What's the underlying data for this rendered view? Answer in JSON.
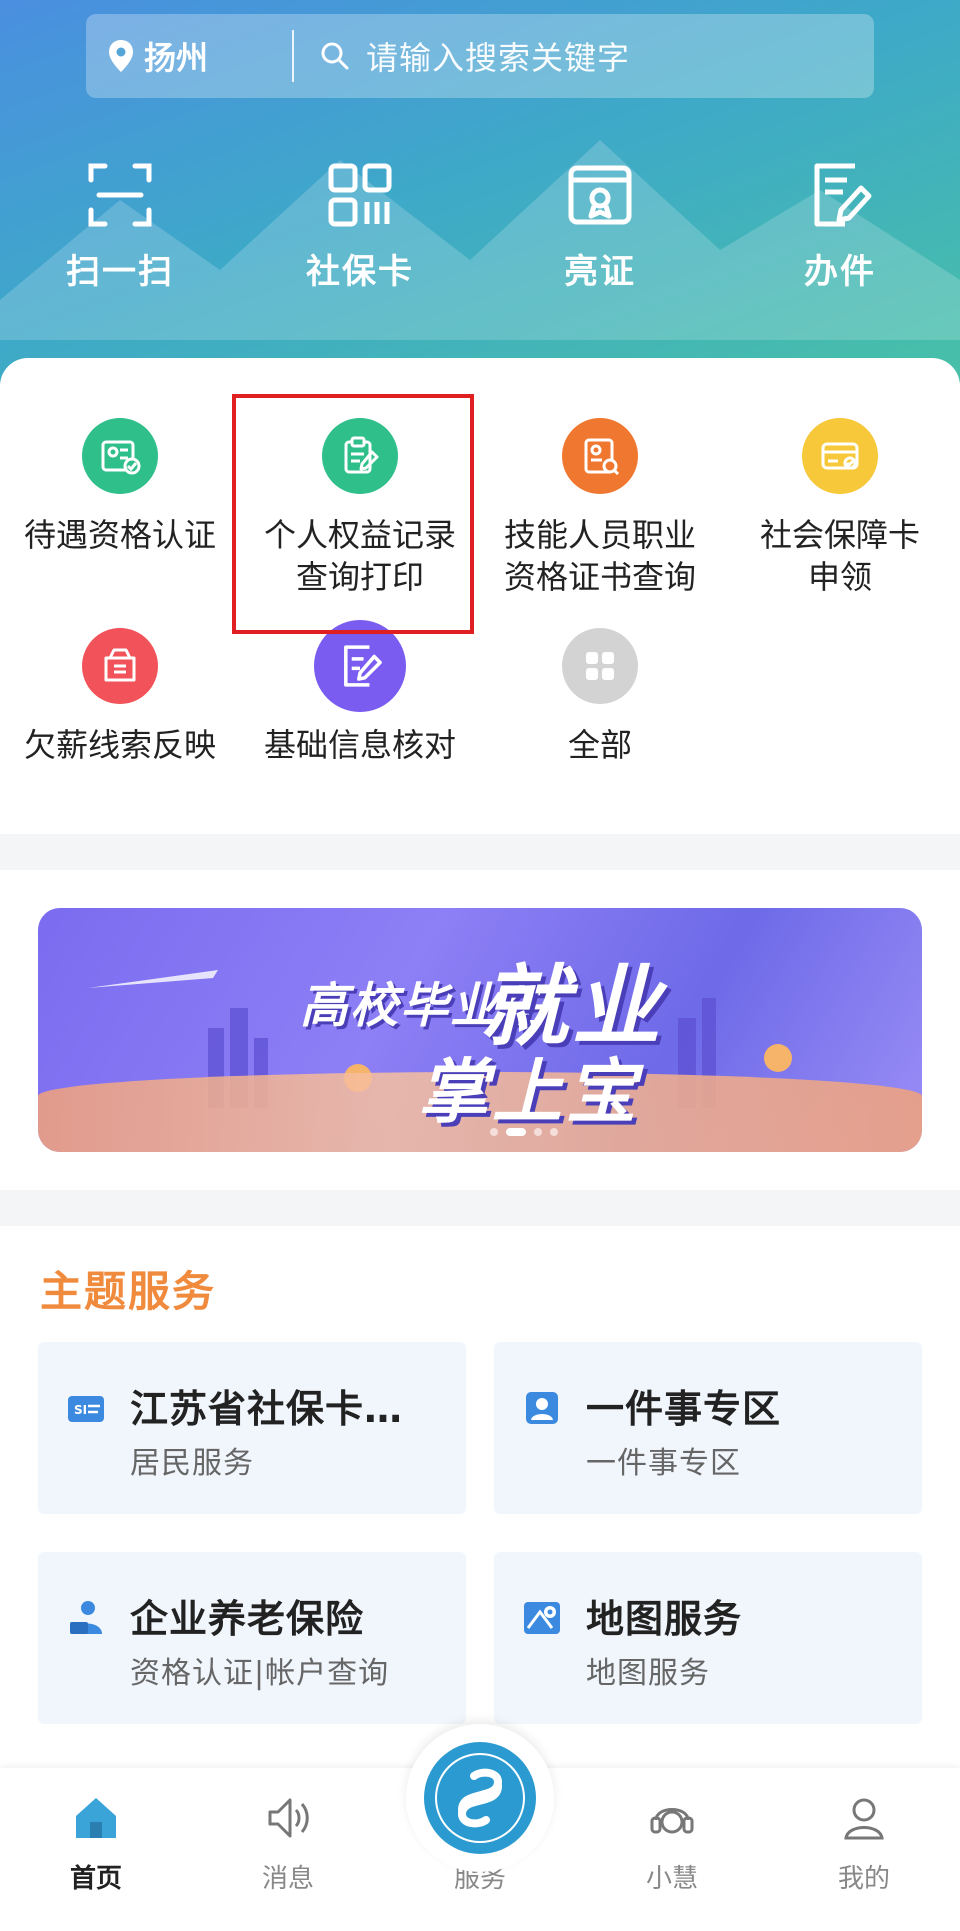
{
  "header": {
    "location": "扬州",
    "search_placeholder": "请输入搜索关键字",
    "quick_actions": [
      {
        "label": "扫一扫",
        "icon": "scan-icon"
      },
      {
        "label": "社保卡",
        "icon": "qr-card-icon"
      },
      {
        "label": "亮证",
        "icon": "certificate-icon"
      },
      {
        "label": "办件",
        "icon": "edit-document-icon"
      }
    ]
  },
  "services": [
    {
      "label": "待遇资格认证",
      "icon": "id-verify-icon",
      "color": "#2fbf8a"
    },
    {
      "label": "个人权益记录\n查询打印",
      "icon": "clipboard-edit-icon",
      "color": "#2fbf8a"
    },
    {
      "label": "技能人员职业\n资格证书查询",
      "icon": "certificate-search-icon",
      "color": "#f0772f"
    },
    {
      "label": "社会保障卡\n申领",
      "icon": "card-apply-icon",
      "color": "#f7c83a"
    },
    {
      "label": "欠薪线索反映",
      "icon": "wallet-icon",
      "color": "#f2535a"
    },
    {
      "label": "基础信息核对",
      "icon": "pencil-note-icon",
      "color": "#7a5cf0"
    },
    {
      "label": "全部",
      "icon": "grid-icon",
      "color": "#d3d3d3"
    }
  ],
  "banner": {
    "line1": "高校毕业生",
    "line2": "就业",
    "line3": "掌上宝"
  },
  "theme": {
    "title": "主题服务",
    "tiles": [
      {
        "name": "江苏省社保卡…",
        "sub": "居民服务",
        "icon": "si-card-icon"
      },
      {
        "name": "一件事专区",
        "sub": "一件事专区",
        "icon": "person-card-icon"
      },
      {
        "name": "企业养老保险",
        "sub": "资格认证|帐户查询",
        "icon": "pension-icon"
      },
      {
        "name": "地图服务",
        "sub": "地图服务",
        "icon": "map-pin-icon"
      }
    ]
  },
  "nav": [
    {
      "label": "首页",
      "icon": "home-icon"
    },
    {
      "label": "消息",
      "icon": "speaker-icon"
    },
    {
      "label": "服务",
      "icon": "service-logo-icon"
    },
    {
      "label": "小慧",
      "icon": "headset-icon"
    },
    {
      "label": "我的",
      "icon": "user-icon"
    }
  ]
}
